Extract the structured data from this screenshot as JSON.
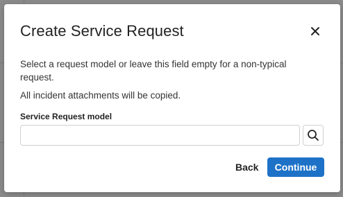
{
  "dialog": {
    "title": "Create Service Request",
    "description": "Select a request model or leave this field empty for a non-typical request.",
    "attachments_note": "All incident attachments will be copied.",
    "field": {
      "label": "Service Request model",
      "value": "",
      "placeholder": ""
    },
    "buttons": {
      "back": "Back",
      "continue": "Continue"
    },
    "icons": {
      "close": "close-icon",
      "search": "search-icon"
    }
  },
  "colors": {
    "primary": "#1d72c8",
    "overlay": "rgba(0,0,0,0.45)"
  }
}
